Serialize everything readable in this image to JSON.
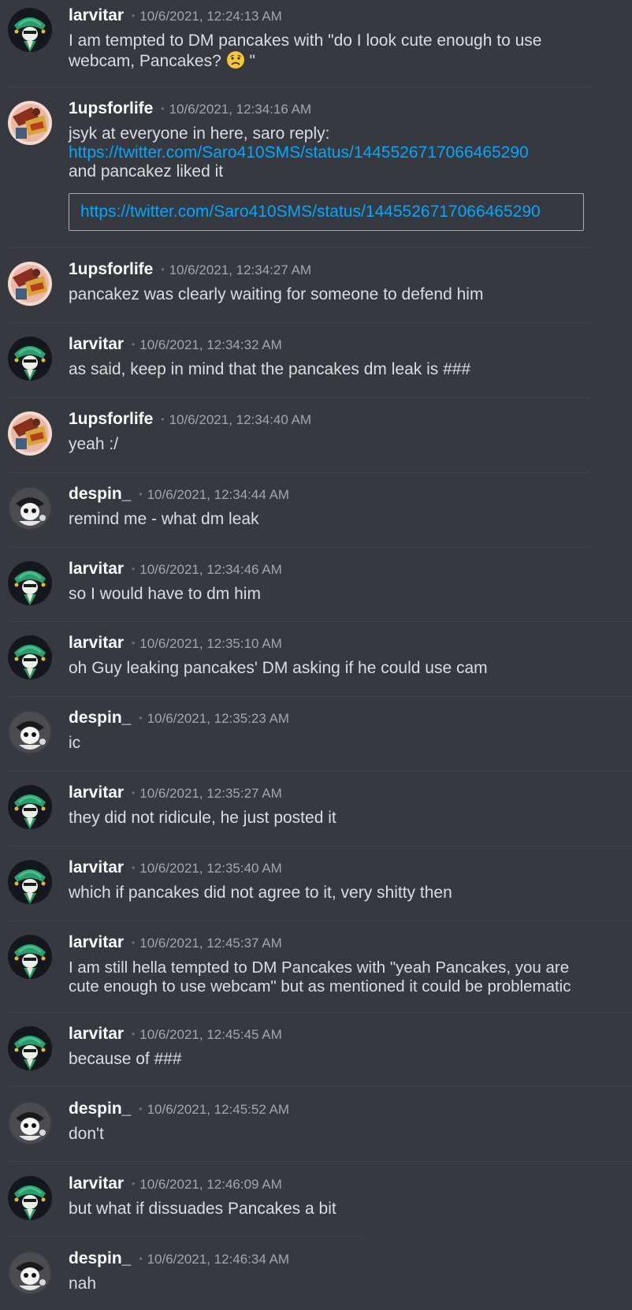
{
  "messages": [
    {
      "author": "larvitar",
      "avatar": "larvitar-avatar",
      "timestamp": "10/6/2021, 12:24:13 AM",
      "lines": [
        "I am tempted to DM pancakes with \"do I look cute enough to use",
        "webcam, Pancakes?"
      ],
      "line2_tail": " \"",
      "emoji": "frowning-face-emoji"
    },
    {
      "author": "1upsforlife",
      "avatar": "1upsforlife-avatar",
      "timestamp": "10/6/2021, 12:34:16 AM",
      "lines": [
        "jsyk at everyone in here, saro reply:"
      ],
      "link": "https://twitter.com/Saro410SMS/status/1445526717066465290",
      "after_link": "and pancakez liked it",
      "embed_link": "https://twitter.com/Saro410SMS/status/1445526717066465290"
    },
    {
      "author": "1upsforlife",
      "avatar": "1upsforlife-avatar",
      "timestamp": "10/6/2021, 12:34:27 AM",
      "lines": [
        "pancakez was clearly waiting for someone to defend him"
      ]
    },
    {
      "author": "larvitar",
      "avatar": "larvitar-avatar",
      "timestamp": "10/6/2021, 12:34:32 AM",
      "lines": [
        "as said, keep in mind that the pancakes dm leak is ###"
      ]
    },
    {
      "author": "1upsforlife",
      "avatar": "1upsforlife-avatar",
      "timestamp": "10/6/2021, 12:34:40 AM",
      "lines": [
        "yeah :/"
      ]
    },
    {
      "author": "despin_",
      "avatar": "despin-avatar",
      "timestamp": "10/6/2021, 12:34:44 AM",
      "lines": [
        "remind me - what dm leak"
      ]
    },
    {
      "author": "larvitar",
      "avatar": "larvitar-avatar",
      "timestamp": "10/6/2021, 12:34:46 AM",
      "lines": [
        "so I would have to dm him"
      ]
    },
    {
      "author": "larvitar",
      "avatar": "larvitar-avatar",
      "timestamp": "10/6/2021, 12:35:10 AM",
      "lines": [
        "oh Guy leaking pancakes' DM asking if he could use cam"
      ]
    },
    {
      "author": "despin_",
      "avatar": "despin-avatar",
      "timestamp": "10/6/2021, 12:35:23 AM",
      "lines": [
        "ic"
      ]
    },
    {
      "author": "larvitar",
      "avatar": "larvitar-avatar",
      "timestamp": "10/6/2021, 12:35:27 AM",
      "lines": [
        "they did not ridicule, he just posted it"
      ]
    },
    {
      "author": "larvitar",
      "avatar": "larvitar-avatar",
      "timestamp": "10/6/2021, 12:35:40 AM",
      "lines": [
        "which if pancakes did not agree to it, very shitty then"
      ]
    },
    {
      "author": "larvitar",
      "avatar": "larvitar-avatar",
      "timestamp": "10/6/2021, 12:45:37 AM",
      "lines": [
        "I am still hella tempted to DM Pancakes with \"yeah Pancakes, you are",
        "cute enough to use webcam\" but as mentioned it could be problematic"
      ]
    },
    {
      "author": "larvitar",
      "avatar": "larvitar-avatar",
      "timestamp": "10/6/2021, 12:45:45 AM",
      "lines": [
        "because of ###"
      ]
    },
    {
      "author": "despin_",
      "avatar": "despin-avatar",
      "timestamp": "10/6/2021, 12:45:52 AM",
      "lines": [
        "don't"
      ]
    },
    {
      "author": "larvitar",
      "avatar": "larvitar-avatar",
      "timestamp": "10/6/2021, 12:46:09 AM",
      "lines": [
        "but what if dissuades Pancakes a bit"
      ]
    },
    {
      "author": "despin_",
      "avatar": "despin-avatar",
      "timestamp": "10/6/2021, 12:46:34 AM",
      "lines": [
        "nah"
      ]
    }
  ],
  "colors": {
    "background": "#36393f",
    "author": "#ffffff",
    "text": "#dcddde",
    "timestamp": "#a3a6aa",
    "link": "#00a8fc"
  }
}
